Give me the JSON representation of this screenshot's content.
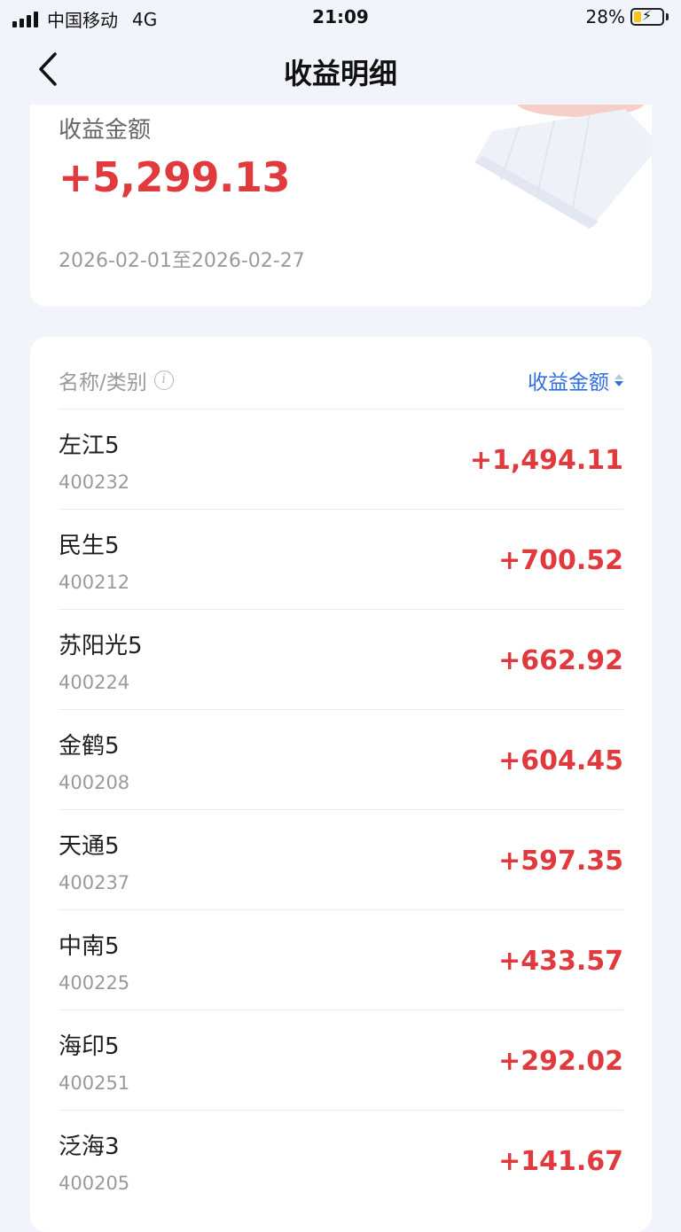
{
  "status": {
    "carrier": "中国移动",
    "network": "4G",
    "time": "21:09",
    "battery": "28%",
    "battery_level": 0.28
  },
  "nav": {
    "title": "收益明细"
  },
  "summary": {
    "label": "收益金额",
    "value": "+5,299.13",
    "range": "2026-02-01至2026-02-27"
  },
  "list": {
    "col_name": "名称/类别",
    "col_value": "收益金额",
    "rows": [
      {
        "name": "左江5",
        "code": "400232",
        "value": "+1,494.11"
      },
      {
        "name": "民生5",
        "code": "400212",
        "value": "+700.52"
      },
      {
        "name": "苏阳光5",
        "code": "400224",
        "value": "+662.92"
      },
      {
        "name": "金鹤5",
        "code": "400208",
        "value": "+604.45"
      },
      {
        "name": "天通5",
        "code": "400237",
        "value": "+597.35"
      },
      {
        "name": "中南5",
        "code": "400225",
        "value": "+433.57"
      },
      {
        "name": "海印5",
        "code": "400251",
        "value": "+292.02"
      },
      {
        "name": "泛海3",
        "code": "400205",
        "value": "+141.67"
      }
    ]
  },
  "colors": {
    "gain": "#e03a3e",
    "accent": "#2f6fe0",
    "background": "#f2f4fb"
  }
}
